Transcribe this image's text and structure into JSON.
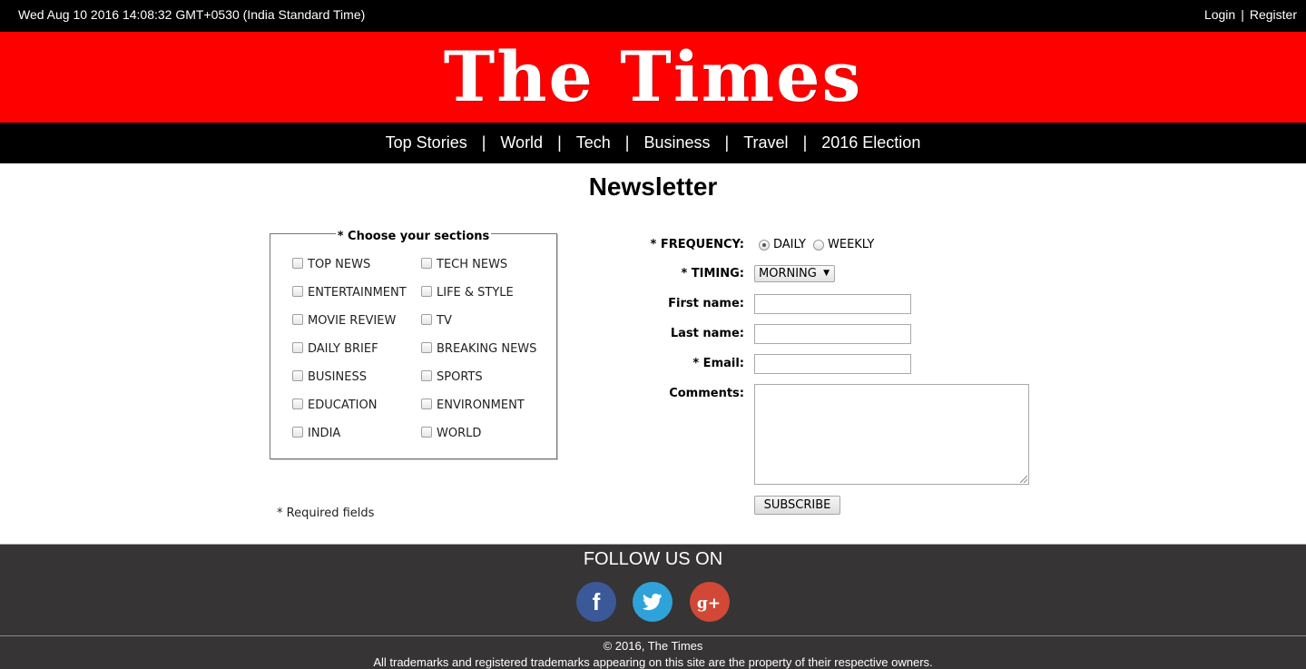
{
  "topbar": {
    "datetime": "Wed Aug 10 2016 14:08:32 GMT+0530 (India Standard Time)",
    "login": "Login",
    "separator": "|",
    "register": "Register"
  },
  "masthead": {
    "logo_text": "The Times",
    "background": "#ff0000"
  },
  "nav": {
    "items": [
      "Top Stories",
      "World",
      "Tech",
      "Business",
      "Travel",
      "2016 Election"
    ],
    "separator": "|"
  },
  "page": {
    "title": "Newsletter"
  },
  "sections": {
    "legend": "* Choose your sections",
    "items": [
      "TOP NEWS",
      "TECH NEWS",
      "ENTERTAINMENT",
      "LIFE & STYLE",
      "MOVIE REVIEW",
      "TV",
      "DAILY BRIEF",
      "BREAKING NEWS",
      "BUSINESS",
      "SPORTS",
      "EDUCATION",
      "ENVIRONMENT",
      "INDIA",
      "WORLD"
    ]
  },
  "form": {
    "frequency_label": "* FREQUENCY:",
    "frequency_options": [
      "DAILY",
      "WEEKLY"
    ],
    "frequency_selected": "DAILY",
    "timing_label": "* TIMING:",
    "timing_value": "MORNING",
    "first_name_label": "First name:",
    "last_name_label": "Last name:",
    "email_label": "* Email:",
    "comments_label": "Comments:",
    "first_name_value": "",
    "last_name_value": "",
    "email_value": "",
    "comments_value": "",
    "subscribe_label": "SUBSCRIBE"
  },
  "required_note": "* Required fields",
  "footer": {
    "follow_text": "FOLLOW US ON",
    "social": [
      {
        "name": "facebook-icon",
        "color": "#3b5998"
      },
      {
        "name": "twitter-icon",
        "color": "#2fa3d9"
      },
      {
        "name": "google-plus-icon",
        "color": "#d14836"
      }
    ],
    "copyright": "© 2016, The Times",
    "trademark": "All trademarks and registered trademarks appearing on this site are the property of their respective owners."
  }
}
